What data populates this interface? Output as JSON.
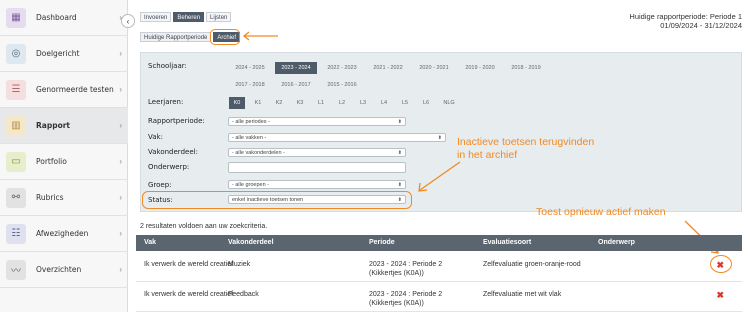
{
  "sidebar": {
    "items": [
      {
        "label": "Dashboard",
        "icon": "grid-icon",
        "color": "#e6dcef",
        "glyph": "▦"
      },
      {
        "label": "Doelgericht",
        "icon": "target-icon",
        "color": "#dfe8ee",
        "glyph": "◎"
      },
      {
        "label": "Genormeerde testen",
        "icon": "list-icon",
        "color": "#f5dede",
        "glyph": "☰"
      },
      {
        "label": "Rapport",
        "icon": "bar-chart-icon",
        "color": "#f5e7c9",
        "glyph": "▥"
      },
      {
        "label": "Portfolio",
        "icon": "folder-icon",
        "color": "#e6eecb",
        "glyph": "▭"
      },
      {
        "label": "Rubrics",
        "icon": "network-icon",
        "color": "#e2e2e2",
        "glyph": "⚯"
      },
      {
        "label": "Afwezigheden",
        "icon": "checklist-icon",
        "color": "#dfe1ee",
        "glyph": "☷"
      },
      {
        "label": "Overzichten",
        "icon": "trend-icon",
        "color": "#e2e2e2",
        "glyph": "〰"
      }
    ]
  },
  "tabs": [
    "Invoeren",
    "Beheren",
    "Lijsten"
  ],
  "subtabs": [
    "Huidige Rapportperiode",
    "Archief"
  ],
  "period": {
    "line1": "Huidige rapportperiode: Periode 1",
    "line2": "01/09/2024 - 31/12/2024"
  },
  "filters": {
    "schooljaar_label": "Schooljaar:",
    "years_row1": [
      "2024 - 2025",
      "2023 - 2024",
      "2022 - 2023",
      "2021 - 2022",
      "2020 - 2021",
      "2019 - 2020",
      "2018 - 2019"
    ],
    "years_row2": [
      "2017 - 2018",
      "2016 - 2017",
      "2015 - 2016"
    ],
    "leerjaren_label": "Leerjaren:",
    "leerjaren": [
      "K0",
      "K1",
      "K2",
      "K3",
      "L1",
      "L2",
      "L3",
      "L4",
      "L5",
      "L6",
      "NLG"
    ],
    "rapportperiode_label": "Rapportperiode:",
    "rapportperiode_value": "- alle periodes -",
    "vak_label": "Vak:",
    "vak_value": "- alle vakken -",
    "vakonderdeel_label": "Vakonderdeel:",
    "vakonderdeel_value": "- alle vakonderdelen -",
    "onderwerp_label": "Onderwerp:",
    "groep_label": "Groep:",
    "groep_value": "- alle groepen -",
    "status_label": "Status:",
    "status_value": "enkel inactieve toetsen tonen"
  },
  "annotations": {
    "archief_note_1": "Inactieve toetsen terugvinden",
    "archief_note_2": "in het archief",
    "reactivate_note": "Toest opnieuw actief maken"
  },
  "result_count": "2 resultaten voldoen aan uw zoekcriteria.",
  "table": {
    "headers": [
      "Vak",
      "Vakonderdeel",
      "Periode",
      "Evaluatiesoort",
      "Onderwerp"
    ],
    "rows": [
      {
        "vak": "Ik verwerk de wereld creatief",
        "vakonderdeel": "Muziek",
        "periode1": "2023 - 2024 : Periode 2",
        "periode2": "(Kikkertjes (K0A))",
        "evaluatie": "Zelfevaluatie groen-oranje-rood",
        "onderwerp": ""
      },
      {
        "vak": "Ik verwerk de wereld creatief",
        "vakonderdeel": "Feedback",
        "periode1": "2023 - 2024 : Periode 2",
        "periode2": "(Kikkertjes (K0A))",
        "evaluatie": "Zelfevaluatie met wit vlak",
        "onderwerp": ""
      }
    ],
    "delete_glyph": "✖"
  },
  "colors": {
    "accent": "#f08a24",
    "active": "#4e5b68",
    "delete": "#d8392b"
  }
}
